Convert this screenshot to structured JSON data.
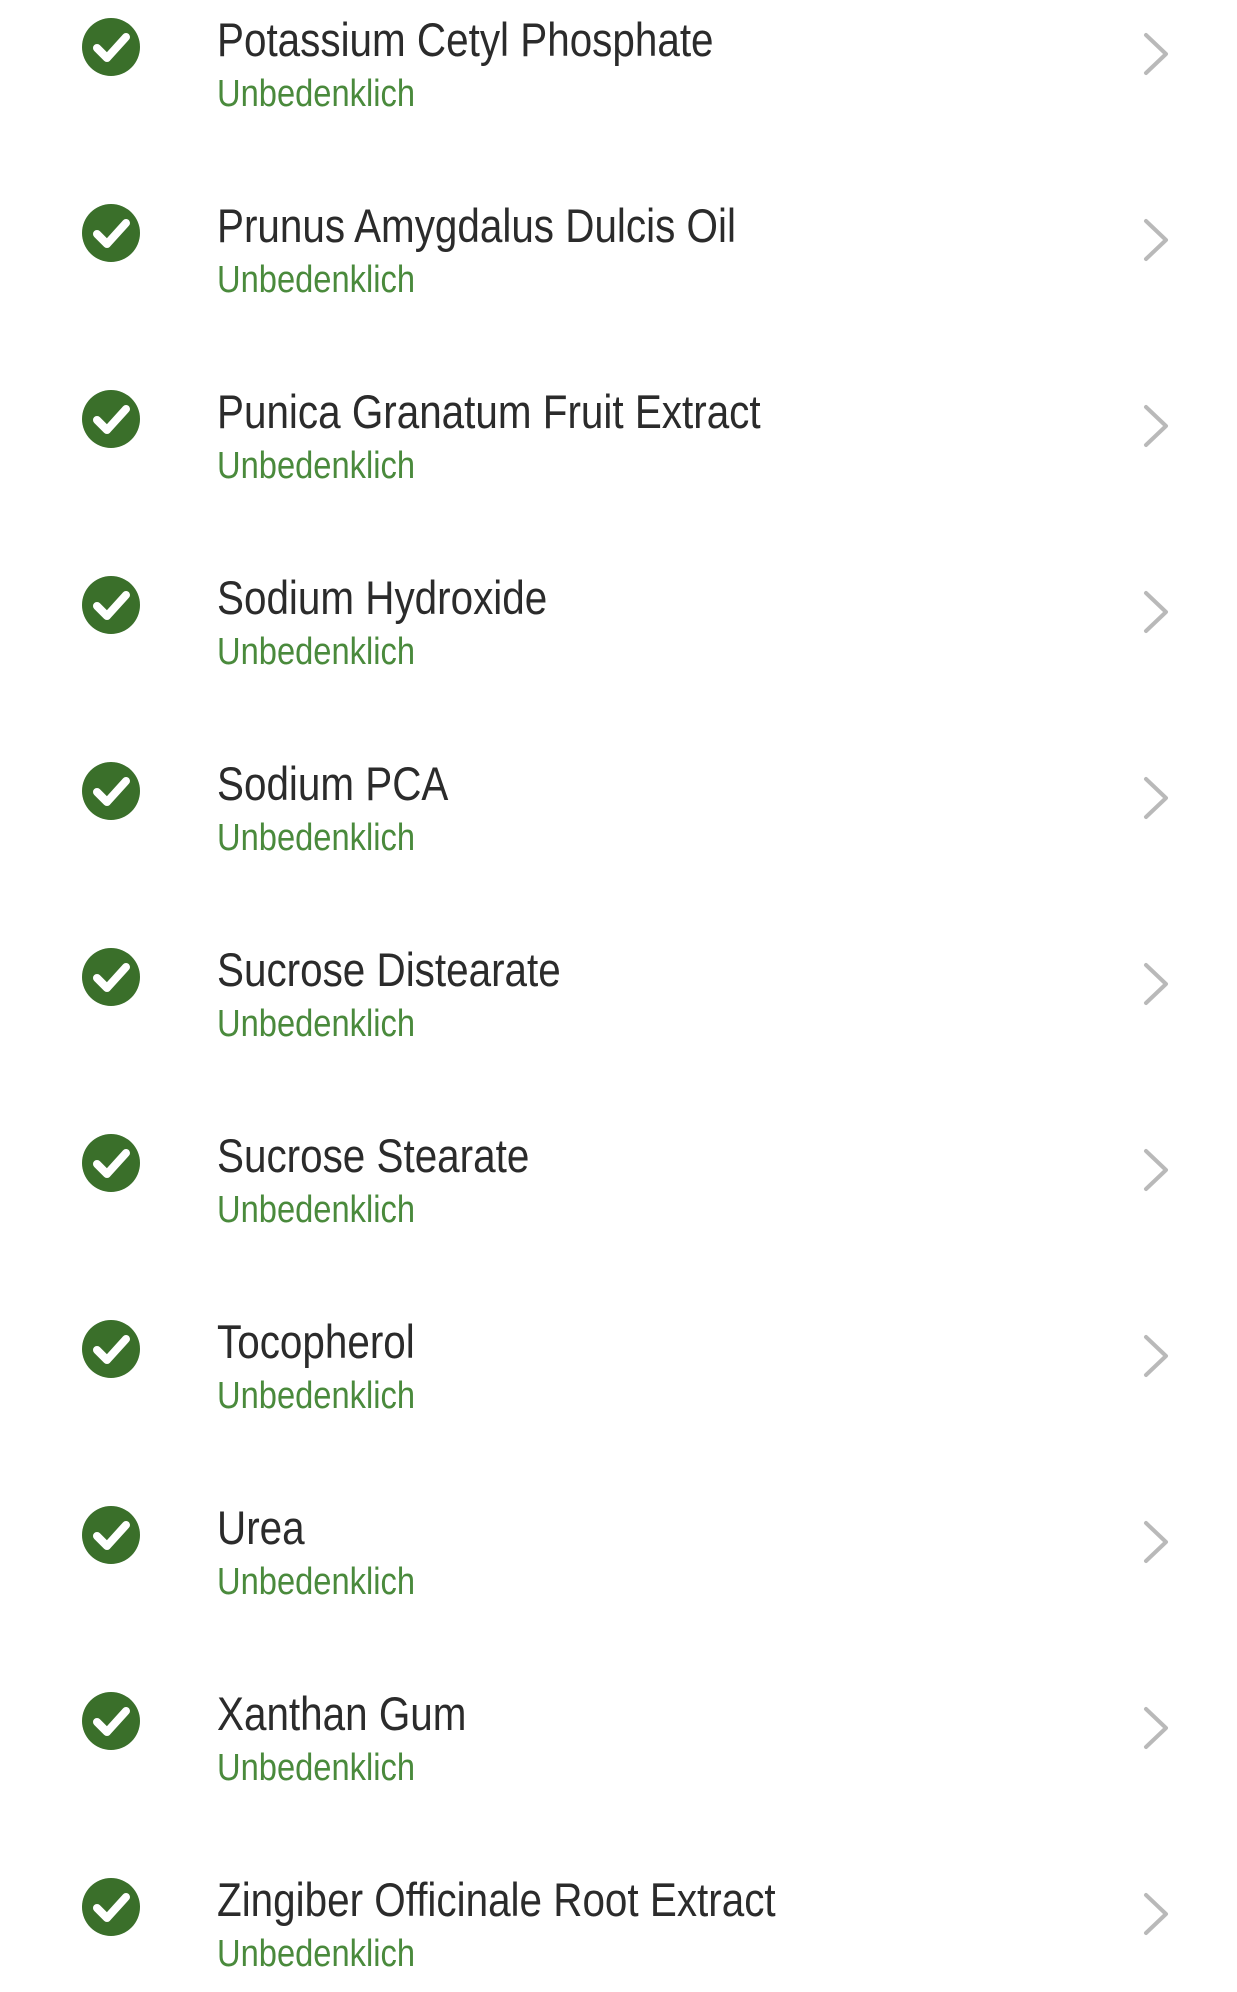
{
  "colors": {
    "safe_green": "#3a6f2a",
    "status_text": "#4a8a3c",
    "name_text": "#2b2b2b",
    "chevron": "#b9b9b9"
  },
  "icons": {
    "status": "check-circle-icon",
    "navigate": "chevron-right-icon"
  },
  "ingredients": [
    {
      "name": "Potassium Cetyl Phosphate",
      "status": "Unbedenklich"
    },
    {
      "name": "Prunus Amygdalus Dulcis Oil",
      "status": "Unbedenklich"
    },
    {
      "name": "Punica Granatum Fruit Extract",
      "status": "Unbedenklich"
    },
    {
      "name": "Sodium Hydroxide",
      "status": "Unbedenklich"
    },
    {
      "name": "Sodium PCA",
      "status": "Unbedenklich"
    },
    {
      "name": "Sucrose Distearate",
      "status": "Unbedenklich"
    },
    {
      "name": "Sucrose Stearate",
      "status": "Unbedenklich"
    },
    {
      "name": "Tocopherol",
      "status": "Unbedenklich"
    },
    {
      "name": "Urea",
      "status": "Unbedenklich"
    },
    {
      "name": "Xanthan Gum",
      "status": "Unbedenklich"
    },
    {
      "name": "Zingiber Officinale Root Extract",
      "status": "Unbedenklich"
    }
  ]
}
